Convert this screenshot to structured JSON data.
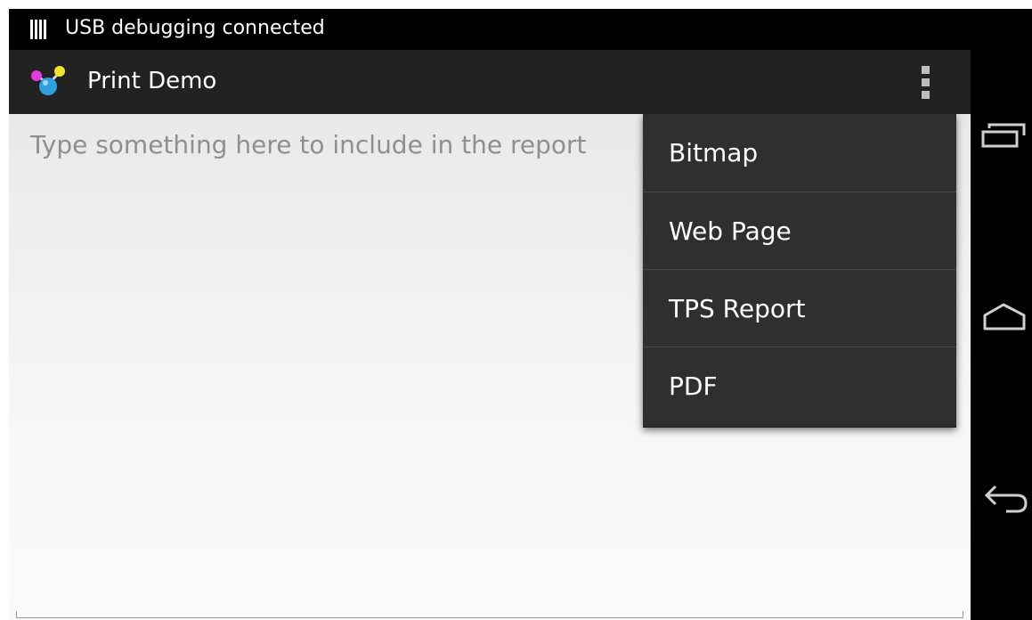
{
  "status_bar": {
    "notification_icon": "usb-debugging-icon",
    "text": "USB debugging connected"
  },
  "action_bar": {
    "app_icon": "print-demo-app-icon",
    "title": "Print Demo",
    "overflow_icon": "overflow-menu-icon"
  },
  "content": {
    "input_placeholder": "Type something here to include in the report",
    "input_value": ""
  },
  "overflow_menu": {
    "items": [
      {
        "label": "Bitmap"
      },
      {
        "label": "Web Page"
      },
      {
        "label": "TPS Report"
      },
      {
        "label": "PDF"
      }
    ]
  },
  "nav_bar": {
    "recents_icon": "recent-apps-icon",
    "home_icon": "home-icon",
    "back_icon": "back-icon"
  },
  "colors": {
    "status_bar_bg": "#000000",
    "action_bar_bg": "#222222",
    "menu_bg": "#2f2f2f",
    "menu_divider": "#474747",
    "placeholder_text": "#8f8f8f"
  }
}
